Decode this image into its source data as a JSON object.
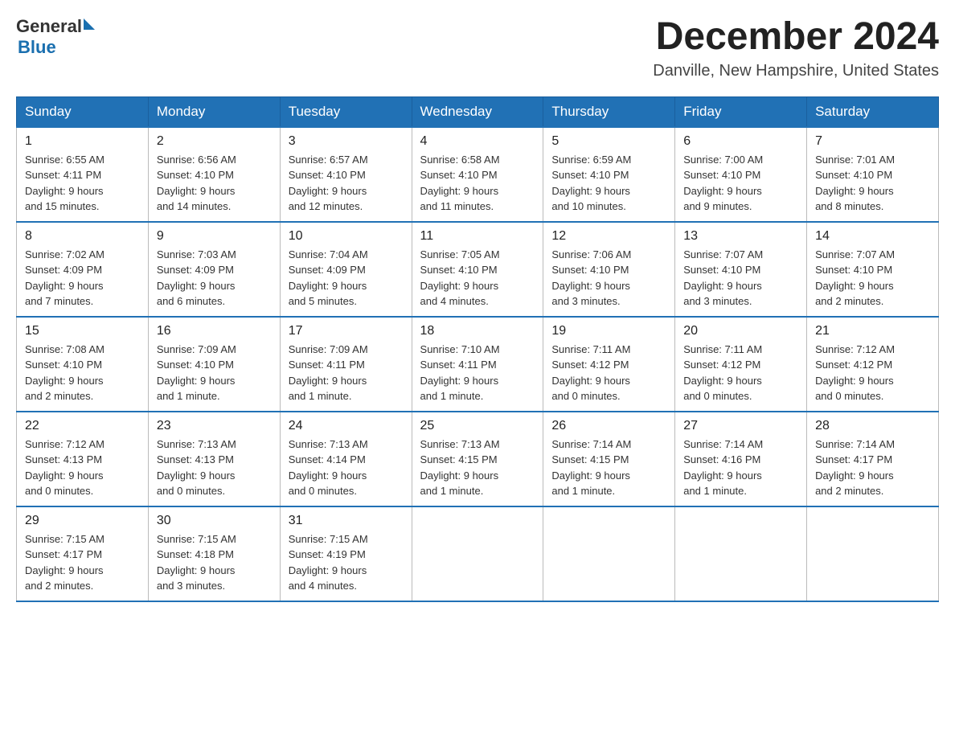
{
  "header": {
    "logo_text_general": "General",
    "logo_text_blue": "Blue",
    "month_title": "December 2024",
    "location": "Danville, New Hampshire, United States"
  },
  "days_of_week": [
    "Sunday",
    "Monday",
    "Tuesday",
    "Wednesday",
    "Thursday",
    "Friday",
    "Saturday"
  ],
  "weeks": [
    [
      {
        "day": "1",
        "sunrise": "6:55 AM",
        "sunset": "4:11 PM",
        "daylight": "9 hours and 15 minutes."
      },
      {
        "day": "2",
        "sunrise": "6:56 AM",
        "sunset": "4:10 PM",
        "daylight": "9 hours and 14 minutes."
      },
      {
        "day": "3",
        "sunrise": "6:57 AM",
        "sunset": "4:10 PM",
        "daylight": "9 hours and 12 minutes."
      },
      {
        "day": "4",
        "sunrise": "6:58 AM",
        "sunset": "4:10 PM",
        "daylight": "9 hours and 11 minutes."
      },
      {
        "day": "5",
        "sunrise": "6:59 AM",
        "sunset": "4:10 PM",
        "daylight": "9 hours and 10 minutes."
      },
      {
        "day": "6",
        "sunrise": "7:00 AM",
        "sunset": "4:10 PM",
        "daylight": "9 hours and 9 minutes."
      },
      {
        "day": "7",
        "sunrise": "7:01 AM",
        "sunset": "4:10 PM",
        "daylight": "9 hours and 8 minutes."
      }
    ],
    [
      {
        "day": "8",
        "sunrise": "7:02 AM",
        "sunset": "4:09 PM",
        "daylight": "9 hours and 7 minutes."
      },
      {
        "day": "9",
        "sunrise": "7:03 AM",
        "sunset": "4:09 PM",
        "daylight": "9 hours and 6 minutes."
      },
      {
        "day": "10",
        "sunrise": "7:04 AM",
        "sunset": "4:09 PM",
        "daylight": "9 hours and 5 minutes."
      },
      {
        "day": "11",
        "sunrise": "7:05 AM",
        "sunset": "4:10 PM",
        "daylight": "9 hours and 4 minutes."
      },
      {
        "day": "12",
        "sunrise": "7:06 AM",
        "sunset": "4:10 PM",
        "daylight": "9 hours and 3 minutes."
      },
      {
        "day": "13",
        "sunrise": "7:07 AM",
        "sunset": "4:10 PM",
        "daylight": "9 hours and 3 minutes."
      },
      {
        "day": "14",
        "sunrise": "7:07 AM",
        "sunset": "4:10 PM",
        "daylight": "9 hours and 2 minutes."
      }
    ],
    [
      {
        "day": "15",
        "sunrise": "7:08 AM",
        "sunset": "4:10 PM",
        "daylight": "9 hours and 2 minutes."
      },
      {
        "day": "16",
        "sunrise": "7:09 AM",
        "sunset": "4:10 PM",
        "daylight": "9 hours and 1 minute."
      },
      {
        "day": "17",
        "sunrise": "7:09 AM",
        "sunset": "4:11 PM",
        "daylight": "9 hours and 1 minute."
      },
      {
        "day": "18",
        "sunrise": "7:10 AM",
        "sunset": "4:11 PM",
        "daylight": "9 hours and 1 minute."
      },
      {
        "day": "19",
        "sunrise": "7:11 AM",
        "sunset": "4:12 PM",
        "daylight": "9 hours and 0 minutes."
      },
      {
        "day": "20",
        "sunrise": "7:11 AM",
        "sunset": "4:12 PM",
        "daylight": "9 hours and 0 minutes."
      },
      {
        "day": "21",
        "sunrise": "7:12 AM",
        "sunset": "4:12 PM",
        "daylight": "9 hours and 0 minutes."
      }
    ],
    [
      {
        "day": "22",
        "sunrise": "7:12 AM",
        "sunset": "4:13 PM",
        "daylight": "9 hours and 0 minutes."
      },
      {
        "day": "23",
        "sunrise": "7:13 AM",
        "sunset": "4:13 PM",
        "daylight": "9 hours and 0 minutes."
      },
      {
        "day": "24",
        "sunrise": "7:13 AM",
        "sunset": "4:14 PM",
        "daylight": "9 hours and 0 minutes."
      },
      {
        "day": "25",
        "sunrise": "7:13 AM",
        "sunset": "4:15 PM",
        "daylight": "9 hours and 1 minute."
      },
      {
        "day": "26",
        "sunrise": "7:14 AM",
        "sunset": "4:15 PM",
        "daylight": "9 hours and 1 minute."
      },
      {
        "day": "27",
        "sunrise": "7:14 AM",
        "sunset": "4:16 PM",
        "daylight": "9 hours and 1 minute."
      },
      {
        "day": "28",
        "sunrise": "7:14 AM",
        "sunset": "4:17 PM",
        "daylight": "9 hours and 2 minutes."
      }
    ],
    [
      {
        "day": "29",
        "sunrise": "7:15 AM",
        "sunset": "4:17 PM",
        "daylight": "9 hours and 2 minutes."
      },
      {
        "day": "30",
        "sunrise": "7:15 AM",
        "sunset": "4:18 PM",
        "daylight": "9 hours and 3 minutes."
      },
      {
        "day": "31",
        "sunrise": "7:15 AM",
        "sunset": "4:19 PM",
        "daylight": "9 hours and 4 minutes."
      },
      null,
      null,
      null,
      null
    ]
  ],
  "labels": {
    "sunrise": "Sunrise:",
    "sunset": "Sunset:",
    "daylight": "Daylight:"
  }
}
